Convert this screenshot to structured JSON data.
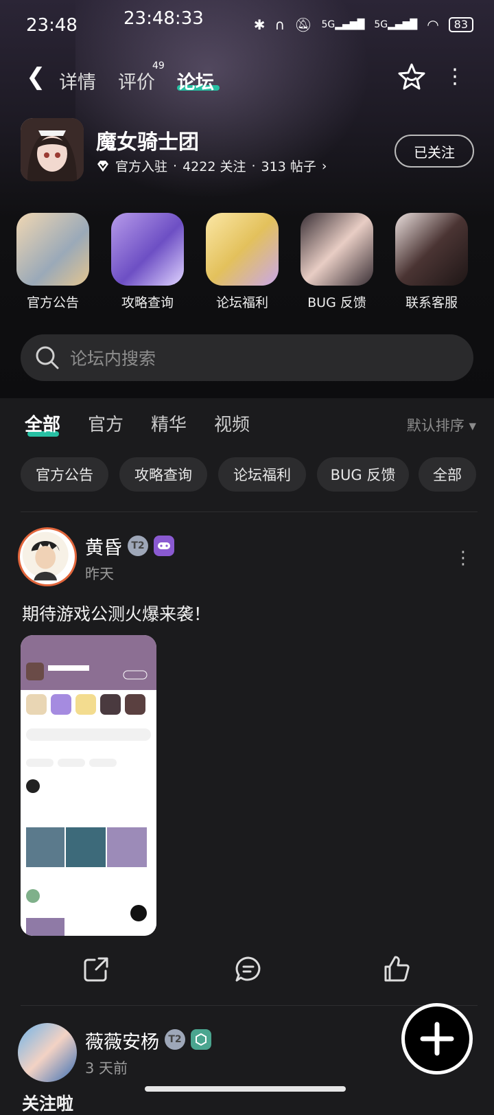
{
  "status_bar": {
    "time": "23:48",
    "overlay_time": "23:48:33",
    "network": "5G",
    "battery": "83"
  },
  "nav": {
    "tabs": [
      {
        "label": "详情"
      },
      {
        "label": "评价",
        "count": "49"
      },
      {
        "label": "论坛"
      }
    ]
  },
  "app": {
    "title": "魔女骑士团",
    "official": "官方入驻",
    "followers": "4222 关注",
    "posts": "313 帖子",
    "follow_button": "已关注"
  },
  "quick_links": [
    {
      "label": "官方公告"
    },
    {
      "label": "攻略查询"
    },
    {
      "label": "论坛福利"
    },
    {
      "label": "BUG 反馈"
    },
    {
      "label": "联系客服"
    }
  ],
  "search": {
    "placeholder": "论坛内搜索"
  },
  "filter_tabs": [
    {
      "label": "全部"
    },
    {
      "label": "官方"
    },
    {
      "label": "精华"
    },
    {
      "label": "视频"
    }
  ],
  "sort_label": "默认排序",
  "chips": [
    {
      "label": "官方公告"
    },
    {
      "label": "攻略查询"
    },
    {
      "label": "论坛福利"
    },
    {
      "label": "BUG 反馈"
    },
    {
      "label": "全部"
    }
  ],
  "posts": [
    {
      "author": "黄昏",
      "time": "昨天",
      "text": "期待游戏公测火爆来袭！"
    },
    {
      "author": "薇薇安杨",
      "time": "3 天前",
      "text": "关注啦"
    }
  ],
  "colors": {
    "accent": "#27c0a3",
    "background": "#1b1b1d",
    "chip": "#2c2c2e"
  }
}
